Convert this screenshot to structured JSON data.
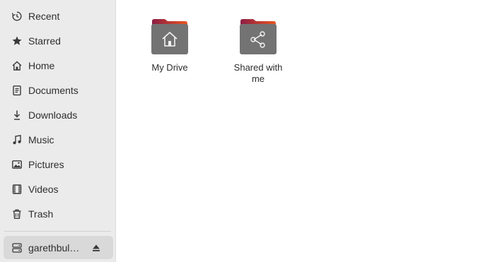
{
  "sidebar": {
    "items": [
      {
        "label": "Recent",
        "icon": "clock-icon"
      },
      {
        "label": "Starred",
        "icon": "star-icon"
      },
      {
        "label": "Home",
        "icon": "home-icon"
      },
      {
        "label": "Documents",
        "icon": "document-icon"
      },
      {
        "label": "Downloads",
        "icon": "download-icon"
      },
      {
        "label": "Music",
        "icon": "music-note-icon"
      },
      {
        "label": "Pictures",
        "icon": "picture-icon"
      },
      {
        "label": "Videos",
        "icon": "film-icon"
      },
      {
        "label": "Trash",
        "icon": "trash-icon"
      }
    ],
    "mount": {
      "label": "garethbul…",
      "icon": "drive-icon",
      "eject_icon": "eject-icon"
    }
  },
  "content": {
    "items": [
      {
        "name": "My Drive",
        "icon": "home-folder-icon"
      },
      {
        "name": "Shared with me",
        "icon": "shared-folder-icon"
      }
    ]
  },
  "colors": {
    "folder_body": "#737373",
    "folder_tab_left": "#8b1e45",
    "folder_tab_right": "#e95420",
    "sidebar_bg": "#ebebeb",
    "selected_bg": "#d9d9d9"
  }
}
